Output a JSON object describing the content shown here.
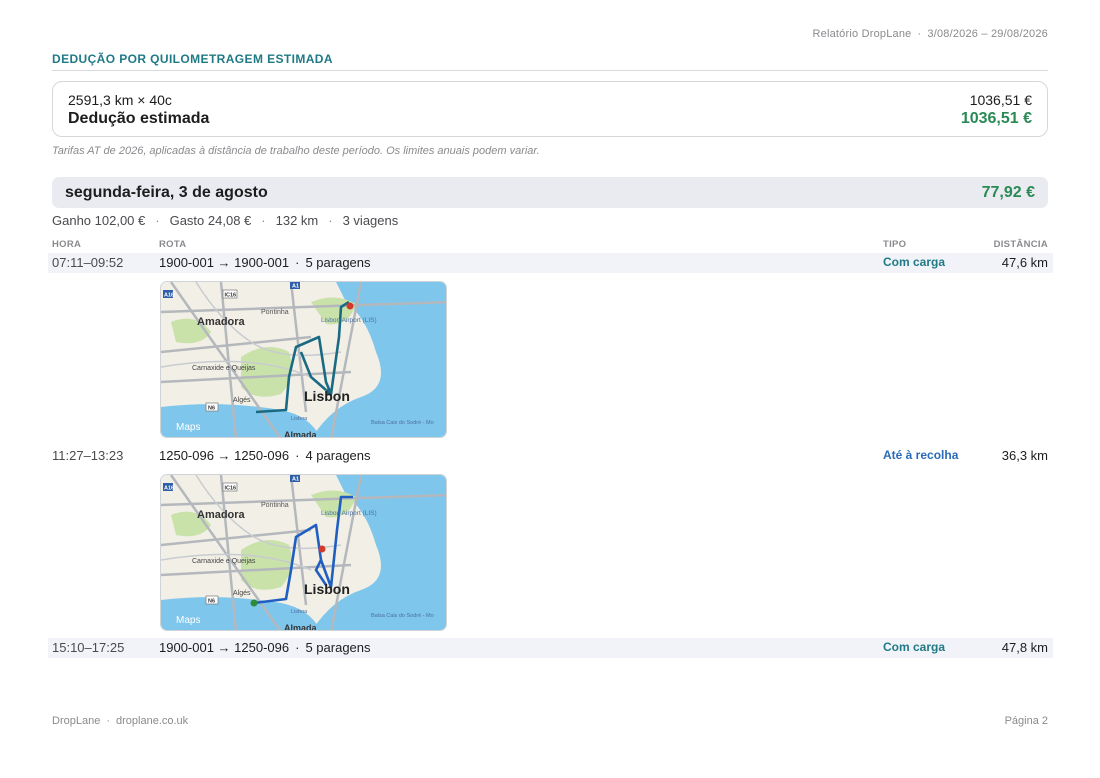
{
  "header": {
    "report_name": "Relatório DropLane",
    "separator": "·",
    "period": "3/08/2026 – 29/08/2026"
  },
  "section": {
    "title": "DEDUÇÃO POR QUILOMETRAGEM ESTIMADA"
  },
  "summary": {
    "calc_label": "2591,3 km × 40c",
    "calc_value": "1036,51 €",
    "deduction_label": "Dedução estimada",
    "deduction_value": "1036,51 €",
    "note": "Tarifas AT de 2026, aplicadas à distância de trabalho deste período. Os limites anuais podem variar."
  },
  "day": {
    "title": "segunda-feira, 3 de agosto",
    "amount": "77,92 €",
    "stats": {
      "earned": "Ganho 102,00 €",
      "spent": "Gasto 24,08 €",
      "distance": "132 km",
      "trips": "3 viagens",
      "separator": "·"
    }
  },
  "columns": {
    "time": "HORA",
    "route": "ROTA",
    "type": "TIPO",
    "distance": "DISTÂNCIA"
  },
  "trips": [
    {
      "time": "07:11–09:52",
      "route": "1900-001 → 1900-001",
      "stops": "5 paragens",
      "type": "Com carga",
      "distance": "47,6 km"
    },
    {
      "time": "11:27–13:23",
      "route": "1250-096 → 1250-096",
      "stops": "4 paragens",
      "type": "Até à recolha",
      "distance": "36,3 km"
    },
    {
      "time": "15:10–17:25",
      "route": "1900-001 → 1250-096",
      "stops": "5 paragens",
      "type": "Com carga",
      "distance": "47,8 km"
    }
  ],
  "map": {
    "labels": {
      "amadora": "Amadora",
      "pontinha": "Pontinha",
      "airport": "Lisbon Airport (LIS)",
      "carnaxide": "Carnaxide e Queijas",
      "alges": "Algés",
      "lisbon": "Lisbon",
      "almada": "Almada",
      "lisboa_sm": "Lisboa",
      "balsa": "Balsa Cais do Sodré - Mo",
      "brand": "Maps",
      "ic16": "IC16",
      "a1": "A1",
      "a16": "A16",
      "n6": "N6"
    },
    "colors": {
      "water": "#7fc6ec",
      "land": "#f2efe6",
      "park": "#c9e2a9",
      "road": "#b4b8bd",
      "route_trip1": "#1a6a84",
      "route_trip2": "#1f5fc2",
      "pin_red": "#d2392b",
      "pin_green": "#2f8a3c"
    }
  },
  "footer": {
    "brand": "DropLane",
    "separator": "·",
    "site": "droplane.co.uk",
    "page": "Página 2"
  }
}
